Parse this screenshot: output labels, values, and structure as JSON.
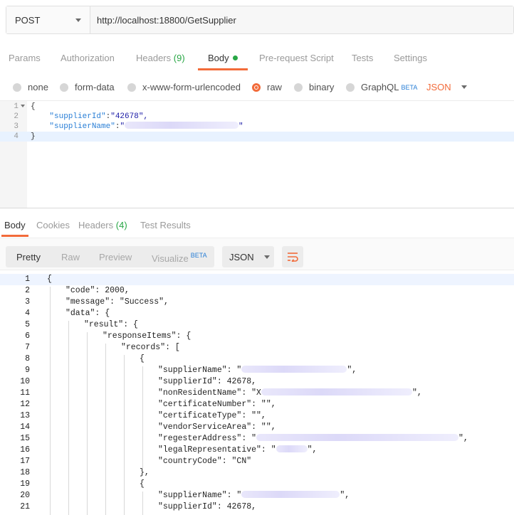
{
  "request": {
    "method": "POST",
    "url": "http://localhost:18800/GetSupplier"
  },
  "request_tabs": [
    {
      "label": "Params"
    },
    {
      "label": "Authorization"
    },
    {
      "label": "Headers",
      "count": "(9)"
    },
    {
      "label": "Body"
    },
    {
      "label": "Pre-request Script"
    },
    {
      "label": "Tests"
    },
    {
      "label": "Settings"
    }
  ],
  "body_options": {
    "none": "none",
    "form_data": "form-data",
    "urlencoded": "x-www-form-urlencoded",
    "raw": "raw",
    "binary": "binary",
    "graphql": "GraphQL",
    "beta": "BETA",
    "format": "JSON",
    "selected": "raw"
  },
  "request_editor": {
    "lines": [
      {
        "n": "1",
        "text": "{"
      },
      {
        "n": "2",
        "key": "\"supplierId\"",
        "sep": ":",
        "value": "\"42678\","
      },
      {
        "n": "3",
        "key": "\"supplierName\"",
        "sep": ":",
        "value_prefix": "\"",
        "value_suffix": "\""
      },
      {
        "n": "4",
        "text": "}"
      }
    ]
  },
  "response_tabs": [
    {
      "label": "Body"
    },
    {
      "label": "Cookies"
    },
    {
      "label": "Headers",
      "count": "(4)"
    },
    {
      "label": "Test Results"
    }
  ],
  "response_toolbar": {
    "pretty": "Pretty",
    "raw": "Raw",
    "preview": "Preview",
    "visualize": "Visualize",
    "beta": "BETA",
    "format": "JSON"
  },
  "response_lines": [
    {
      "n": "1",
      "text": "{"
    },
    {
      "n": "2",
      "text": "\"code\": 2000,"
    },
    {
      "n": "3",
      "text": "\"message\": \"Success\","
    },
    {
      "n": "4",
      "text": "\"data\": {"
    },
    {
      "n": "5",
      "text": "\"result\": {"
    },
    {
      "n": "6",
      "text": "\"responseItems\": {"
    },
    {
      "n": "7",
      "text": "\"records\": ["
    },
    {
      "n": "8",
      "text": "{"
    },
    {
      "n": "9",
      "text": "\"supplierName\": \""
    },
    {
      "n": "10",
      "text": "\"supplierId\": 42678,"
    },
    {
      "n": "11",
      "text": "\"nonResidentName\": \"X"
    },
    {
      "n": "12",
      "text": "\"certificateNumber\": \"\","
    },
    {
      "n": "13",
      "text": "\"certificateType\": \"\","
    },
    {
      "n": "14",
      "text": "\"vendorServiceArea\": \"\","
    },
    {
      "n": "15",
      "text": "\"regesterAddress\": \""
    },
    {
      "n": "16",
      "text": "\"legalRepresentative\": \""
    },
    {
      "n": "17",
      "text": "\"countryCode\": \"CN\""
    },
    {
      "n": "18",
      "text": "},"
    },
    {
      "n": "19",
      "text": "{"
    },
    {
      "n": "20",
      "text": "\"supplierName\": \""
    },
    {
      "n": "21",
      "text": "\"supplierId\": 42678,"
    }
  ],
  "response_tails": {
    "9": "\",",
    "11": "\",",
    "15": "\",",
    "16": "\",",
    "20": "\","
  },
  "colors": {
    "accent": "#f26b3a",
    "count_green": "#28a745",
    "beta_blue": "#2a7fd6"
  }
}
